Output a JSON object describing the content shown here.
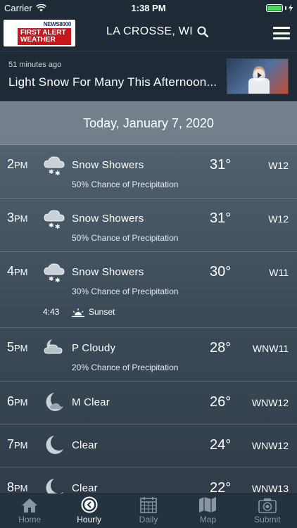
{
  "status": {
    "carrier": "Carrier",
    "time": "1:38 PM"
  },
  "header": {
    "logo_top": "NEWS8000",
    "logo_main": "FIRST ALERT WEATHER",
    "location": "LA CROSSE, WI"
  },
  "news": {
    "time_ago": "51 minutes ago",
    "headline": "Light Snow For Many This Afternoon..."
  },
  "date": "Today, January 7, 2020",
  "hours": [
    {
      "hour": "2",
      "ampm": "PM",
      "icon": "snow-showers-icon",
      "condition": "Snow Showers",
      "precip": "50% Chance of Precipitation",
      "temp": "31°",
      "wind": "W12"
    },
    {
      "hour": "3",
      "ampm": "PM",
      "icon": "snow-showers-icon",
      "condition": "Snow Showers",
      "precip": "50% Chance of Precipitation",
      "temp": "31°",
      "wind": "W12"
    },
    {
      "hour": "4",
      "ampm": "PM",
      "icon": "snow-showers-icon",
      "condition": "Snow Showers",
      "precip": "30% Chance of Precipitation",
      "temp": "30°",
      "wind": "W11",
      "sunset_time": "4:43",
      "sunset_label": "Sunset"
    },
    {
      "hour": "5",
      "ampm": "PM",
      "icon": "partly-cloudy-night-icon",
      "condition": "P Cloudy",
      "precip": "20% Chance of Precipitation",
      "temp": "28°",
      "wind": "WNW11"
    },
    {
      "hour": "6",
      "ampm": "PM",
      "icon": "mostly-clear-night-icon",
      "condition": "M Clear",
      "temp": "26°",
      "wind": "WNW12"
    },
    {
      "hour": "7",
      "ampm": "PM",
      "icon": "moon-icon",
      "condition": "Clear",
      "temp": "24°",
      "wind": "WNW12"
    },
    {
      "hour": "8",
      "ampm": "PM",
      "icon": "moon-icon",
      "condition": "Clear",
      "temp": "22°",
      "wind": "WNW13"
    }
  ],
  "tabs": [
    {
      "label": "Home",
      "icon": "home-icon"
    },
    {
      "label": "Hourly",
      "icon": "clock-icon",
      "active": true
    },
    {
      "label": "Daily",
      "icon": "calendar-icon"
    },
    {
      "label": "Map",
      "icon": "map-icon"
    },
    {
      "label": "Submit",
      "icon": "camera-icon"
    }
  ]
}
